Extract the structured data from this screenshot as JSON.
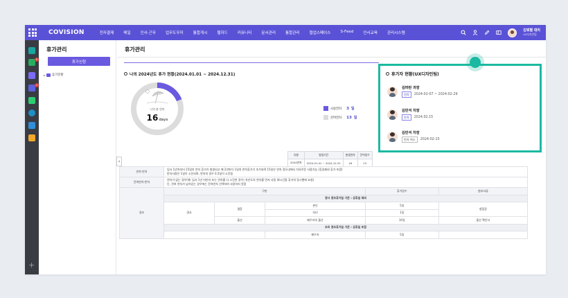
{
  "topnav": {
    "logo": "COVISION",
    "menu": [
      "전자결재",
      "메일",
      "인사·근무",
      "업무도우미",
      "통합게시",
      "웹하드",
      "커뮤니티",
      "문서관리",
      "통합관리",
      "협업스페이스",
      "S-Feed",
      "인사교육",
      "관리시스템"
    ],
    "user_name": "김뭐별 대리",
    "user_dept": "UX디자인팀"
  },
  "sidebar": {
    "title": "휴가관리",
    "primary_button": "휴가신청",
    "tree_item": "휴가현황"
  },
  "rail": {
    "badges": [
      "6",
      "1"
    ]
  },
  "main": {
    "title": "휴가관리",
    "status": {
      "subtitle": "나의 2024년도 휴가 현황(2024.01.01 ~ 2024.12.31)",
      "donut_caption": "나의 총 연차",
      "total_days": "16",
      "days_unit": "days",
      "used_label": "사용연차",
      "used_value": "3",
      "remain_label": "잔여연차",
      "remain_value": "13",
      "unit": "일",
      "used_fraction": 0.19,
      "colors": {
        "used": "#6a5ae0",
        "remain": "#dcdcdc"
      },
      "table": {
        "headers": [
          "유형",
          "발생기간",
          "발생연차",
          "잔여일수"
        ],
        "row": [
          "2024연차",
          "2024.01.01 ~ 2024.12.31",
          "16",
          "13"
        ]
      }
    },
    "vacationers": {
      "title": "휴가자 현황(UX디자인팀)",
      "people": [
        {
          "name": "김파란 과장",
          "tag": "연차",
          "date": "2024-02-07 ~ 2024-02-29"
        },
        {
          "name": "김민석 차장",
          "tag": "반차",
          "date": "2024.02.15"
        },
        {
          "name": "김민석 차장",
          "tag": "반차 취소",
          "date": "2024-02-15"
        }
      ]
    },
    "rules": {
      "rows": [
        {
          "label": "연차·반차",
          "text1": "입사 1년차부터 15일의 연차 휴가가 발생되고 매 2년마다 1일의 연차휴가가 추가되며 15일은 연차 정도내에서 자유로운 사용가능 (휴일제외 휴가 포함)",
          "text2": "반차사용은 1일이 소진되며, 반차의 경우 0.5일이 소진됨"
        },
        {
          "label": "잔여연차·반차",
          "text1": "연차가 없는 경우(예: 입사 1년 미만자 또는 연차를 다 소진한 경우) 차년도의 연차를 먼저 사용 (8시간을 휴가의 정시행에 요청)",
          "text2": "단, 전여 연차가 남아있는 경우에는 잔여연차 선택하여 사용하지 못함"
        }
      ],
      "kyungjo": {
        "label": "경조",
        "headers": [
          "구분",
          "휴가일수",
          "첨부서류"
        ],
        "section1": "경사 경조휴가일 기준 : 공휴일 제외",
        "section2": "조의 경조휴가일 기준 : 공휴일 포함",
        "group": "경사",
        "marriage": "결혼",
        "birth": "출산",
        "self": "본인",
        "child": "자녀",
        "spouse_birth": "배우자의 출산",
        "days_1": "5일",
        "days_2": "1일",
        "days_3": "10일",
        "doc_1": "청첩장",
        "doc_2": "출산 확인서",
        "spouse": "배우자",
        "days_4": "5일"
      }
    }
  }
}
